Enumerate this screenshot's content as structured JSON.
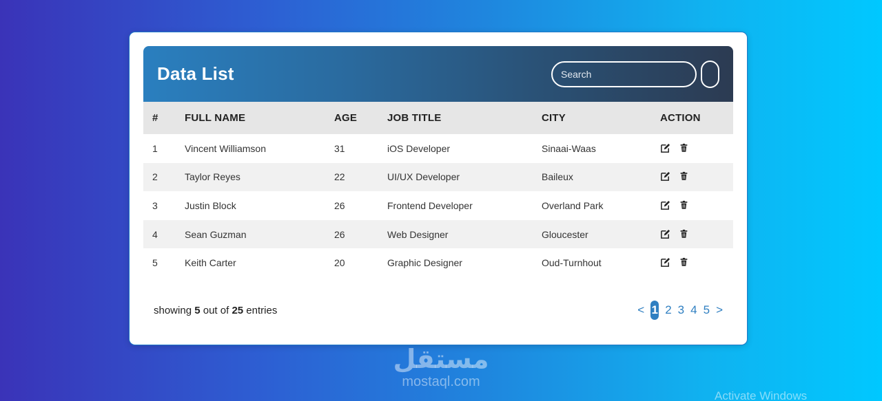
{
  "header": {
    "title": "Data List",
    "search_placeholder": "Search"
  },
  "table": {
    "columns": [
      "#",
      "FULL NAME",
      "AGE",
      "JOB TITLE",
      "CITY",
      "ACTION"
    ],
    "rows": [
      {
        "num": "1",
        "name": "Vincent Williamson",
        "age": "31",
        "job": "iOS Developer",
        "city": "Sinaai-Waas"
      },
      {
        "num": "2",
        "name": "Taylor Reyes",
        "age": "22",
        "job": "UI/UX Developer",
        "city": "Baileux"
      },
      {
        "num": "3",
        "name": "Justin Block",
        "age": "26",
        "job": "Frontend Developer",
        "city": "Overland Park"
      },
      {
        "num": "4",
        "name": "Sean Guzman",
        "age": "26",
        "job": "Web Designer",
        "city": "Gloucester"
      },
      {
        "num": "5",
        "name": "Keith Carter",
        "age": "20",
        "job": "Graphic Designer",
        "city": "Oud-Turnhout"
      }
    ]
  },
  "footer": {
    "showing_prefix": "showing",
    "shown_count": "5",
    "out_of": "out of",
    "total": "25",
    "entries": "entries"
  },
  "pagination": {
    "prev": "<",
    "pages": [
      "1",
      "2",
      "3",
      "4",
      "5"
    ],
    "next": ">"
  },
  "watermark": {
    "logo": "مستقل",
    "text": "mostaql.com"
  },
  "os_overlay": {
    "activate": "Activate Windows"
  },
  "colors": {
    "header_start": "#2a7fbf",
    "header_end": "#2c3b52",
    "accent": "#2f7fc1"
  },
  "icons": {
    "edit": "edit-icon",
    "delete": "trash-icon"
  }
}
